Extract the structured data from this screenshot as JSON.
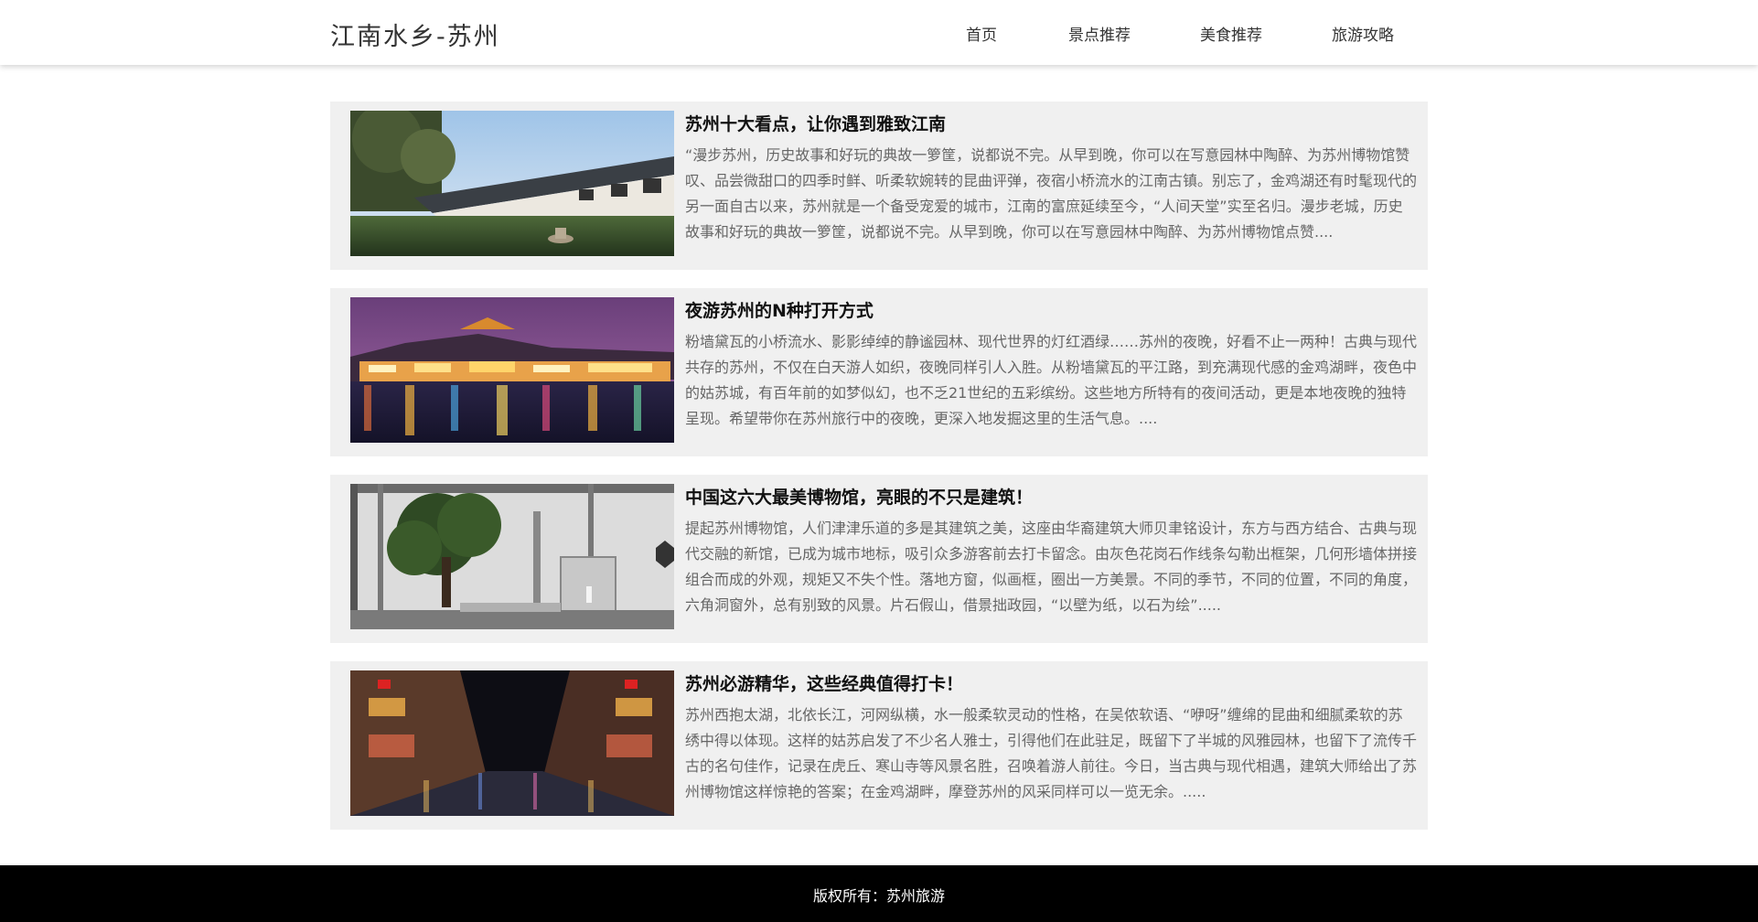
{
  "header": {
    "site_title": "江南水乡-苏州",
    "nav": [
      "首页",
      "景点推荐",
      "美食推荐",
      "旅游攻略"
    ]
  },
  "articles": [
    {
      "title": "苏州十大看点，让你遇到雅致江南",
      "body": "“漫步苏州，历史故事和好玩的典故一箩筐，说都说不完。从早到晚，你可以在写意园林中陶醉、为苏州博物馆赞叹、品尝微甜口的四季时鲜、听柔软婉转的昆曲评弹，夜宿小桥流水的江南古镇。别忘了，金鸡湖还有时髦现代的另一面自古以来，苏州就是一个备受宠爱的城市，江南的富庶延续至今，“人间天堂”实至名归。漫步老城，历史故事和好玩的典故一箩筐，说都说不完。从早到晚，你可以在写意园林中陶醉、为苏州博物馆点赞....",
      "image": "garden-corridor-photo"
    },
    {
      "title": "夜游苏州的N种打开方式",
      "body": "粉墙黛瓦的小桥流水、影影绰绰的静谧园林、现代世界的灯红酒绿……苏州的夜晚，好看不止一两种！古典与现代共存的苏州，不仅在白天游人如织，夜晚同样引人入胜。从粉墙黛瓦的平江路，到充满现代感的金鸡湖畔，夜色中的姑苏城，有百年前的如梦似幻，也不乏21世纪的五彩缤纷。这些地方所特有的夜间活动，更是本地夜晚的独特呈现。希望带你在苏州旅行中的夜晚，更深入地发掘这里的生活气息。....",
      "image": "night-waterfront-photo"
    },
    {
      "title": "中国这六大最美博物馆，亮眼的不只是建筑！",
      "body": "提起苏州博物馆，人们津津乐道的多是其建筑之美，这座由华裔建筑大师贝聿铭设计，东方与西方结合、古典与现代交融的新馆，已成为城市地标，吸引众多游客前去打卡留念。由灰色花岗石作线条勾勒出框架，几何形墙体拼接组合而成的外观，规矩又不失个性。落地方窗，似画框，圈出一方美景。不同的季节，不同的位置，不同的角度，六角洞窗外，总有别致的风景。片石假山，借景拙政园，“以壁为纸，以石为绘”.....",
      "image": "museum-tree-photo"
    },
    {
      "title": "苏州必游精华，这些经典值得打卡！",
      "body": "苏州西抱太湖，北依长江，河网纵横，水一般柔软灵动的性格，在吴侬软语、“咿呀”缠绵的昆曲和细腻柔软的苏绣中得以体现。这样的姑苏启发了不少名人雅士，引得他们在此驻足，既留下了半城的风雅园林，也留下了流传千古的名句佳作，记录在虎丘、寒山寺等风景名胜，召唤着游人前往。今日，当古典与现代相遇，建筑大师给出了苏州博物馆这样惊艳的答案；在金鸡湖畔，摩登苏州的风采同样可以一览无余。.....",
      "image": "night-street-photo"
    }
  ],
  "footer": {
    "copyright": "版权所有：苏州旅游"
  },
  "colors": {
    "card_bg": "#f0f0f0",
    "body_text": "#666666",
    "footer_bg": "#000000"
  }
}
